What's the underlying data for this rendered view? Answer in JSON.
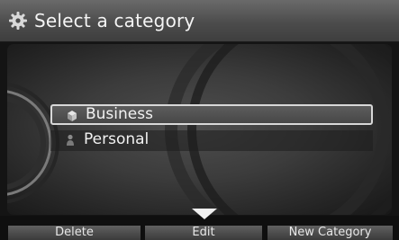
{
  "header": {
    "title": "Select a category",
    "icon": "gear-icon"
  },
  "list": {
    "items": [
      {
        "label": "Business",
        "icon": "business-category-icon",
        "selected": true
      },
      {
        "label": "Personal",
        "icon": "personal-category-icon",
        "selected": false
      }
    ]
  },
  "footer": {
    "delete_label": "Delete",
    "edit_label": "Edit",
    "new_category_label": "New Category"
  },
  "scroll_indicator": {
    "icon": "scroll-down-arrow-icon"
  },
  "colors": {
    "selection_border": "#d8d8d8",
    "text": "#f2f2f2",
    "header_bg": "#555555"
  }
}
